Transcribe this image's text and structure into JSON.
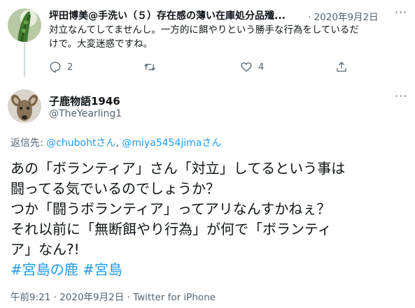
{
  "reply_tweet": {
    "display_name": "坪田博美@手洗い（５）存在感の薄い在庫処分品殲...",
    "date": "· 2020年9月2日",
    "text_lines": [
      "対立なんてしてませんし。一方的に餌やりという勝手な行為をしているだ",
      "けで。大変迷惑ですね。"
    ],
    "actions": {
      "reply_count": "2",
      "like_count": "4"
    }
  },
  "main_tweet": {
    "display_name": "子鹿物語1946",
    "handle": "@TheYearling1",
    "reply_to": {
      "prefix": "返信先: ",
      "user1": "@chubohtさん",
      "separator": ", ",
      "user2": "@miya5454jimaさん"
    },
    "text_lines": [
      "あの「ボランティア」さん「対立」してるという事は",
      "闘ってる気でいるのでしょうか？",
      "つか「闘うボランティア」ってアリなんすかねぇ？",
      "それ以前に「無断餌やり行為」が何で「ボランティ",
      "ア」なん?!"
    ],
    "hashtags": [
      "#宮島の鹿",
      "#宮島"
    ],
    "timestamp": "午前9:21 · 2020年9月2日 · Twitter for iPhone"
  },
  "colors": {
    "link": "#1d9bf0",
    "secondary_text": "#536471",
    "divider": "#cfd9de"
  }
}
